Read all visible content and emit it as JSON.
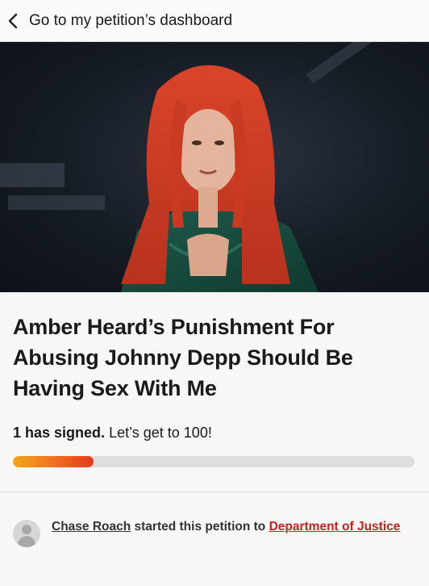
{
  "nav": {
    "back_label": "Go to my petition’s dashboard",
    "back_icon": "chevron-left-icon"
  },
  "hero": {
    "image_description_icon": "petition-photo"
  },
  "petition": {
    "title": "Amber Heard’s Punishment For Abusing Johnny Depp Should Be Having Sex With Me",
    "signed_count": "1 has signed.",
    "goal_text": "Let’s get to 100!",
    "progress_fraction": 0.2
  },
  "starter": {
    "name": "Chase Roach",
    "middle": "started this petition to",
    "target": "Department of Justice"
  },
  "colors": {
    "accent_red": "#cc1f1f",
    "progress_start": "#f4a71c",
    "progress_end": "#e53a1e"
  }
}
